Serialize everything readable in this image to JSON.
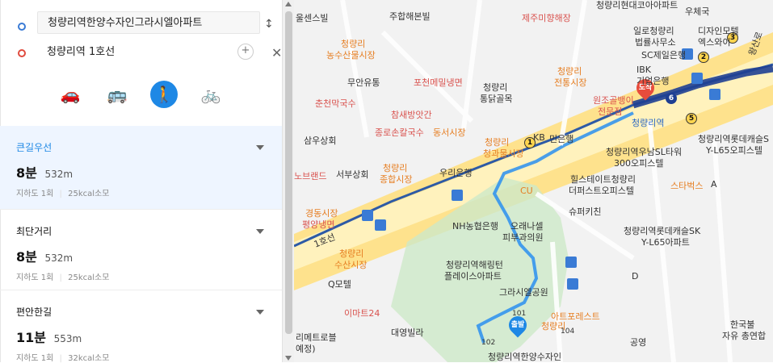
{
  "search": {
    "start_value": "청량리역한양수자인그라시엘아파트",
    "end_value": "청량리역 1호선",
    "add_label": "+",
    "swap_icon": "↕",
    "close_icon": "✕"
  },
  "modes": [
    {
      "name": "car",
      "icon": "🚗"
    },
    {
      "name": "bus",
      "icon": "🚌"
    },
    {
      "name": "walk",
      "icon": "🚶"
    },
    {
      "name": "bike",
      "icon": "🚲"
    }
  ],
  "routes": [
    {
      "title": "큰길우선",
      "time": "8분",
      "dist": "532m",
      "meta1": "지하도 1회",
      "meta2": "25kcal소모",
      "selected": true
    },
    {
      "title": "최단거리",
      "time": "8분",
      "dist": "532m",
      "meta1": "지하도 1회",
      "meta2": "25kcal소모",
      "selected": false
    },
    {
      "title": "편안한길",
      "time": "11분",
      "dist": "553m",
      "meta1": "지하도 1회",
      "meta2": "32kcal소모",
      "selected": false
    }
  ],
  "map": {
    "labels": {
      "l1": "울센스빌",
      "l2": "주합해본빌",
      "l3": "제주미향해장",
      "l4": "청량리현대코아아파트",
      "l5": "우체국",
      "l6": "일로청량리",
      "l7": "법률사무소",
      "l8": "디자인모텔",
      "l9": "엑스와이",
      "l10": "SC제일은행",
      "l11": "IBK",
      "l12": "기업은행",
      "l13": "청량리",
      "l14": "농수산물시장",
      "l15": "무안유통",
      "l16": "포천메밀냉면",
      "l17": "청량리",
      "l18": "통닭골목",
      "l19": "청량리",
      "l20": "전통시장",
      "l21": "원조골뱅이",
      "l22": "전문점",
      "l23": "춘천막국수",
      "l24": "참새방앗간",
      "l25": "종로손칼국수",
      "l26": "동서시장",
      "l27": "청량리",
      "l28": "청과물시장",
      "l29": "KB",
      "l30": "민은행",
      "l31": "청량리역우남SL타워",
      "l32": "300오피스텔",
      "l33": "청량리역롯데캐슬S",
      "l34": "Y-L65오피스텔",
      "l35": "삼우상회",
      "l36": "서부상회",
      "l37": "청량리",
      "l38": "종합시장",
      "l39": "우리은행",
      "l40": "노브랜드",
      "l41": "힐스테이트청량리",
      "l42": "더퍼스트오피스텔",
      "l43": "스타벅스",
      "l44": "경동시장",
      "l45": "평양냉면",
      "l46": "NH농협은행",
      "l47": "슈퍼키친",
      "l48": "청량리역롯데캐슬SK",
      "l49": "Y-L65아파트",
      "l50": "오래나셀",
      "l51": "피부과의원",
      "l52": "청량리",
      "l53": "수산시장",
      "l54": "청량리역해링턴",
      "l55": "플레이스아파트",
      "l56": "Q모텔",
      "l57": "그라시엘공원",
      "l58": "아트포레스트",
      "l59": "청량리",
      "l60": "이마트24",
      "l61": "대영빌라",
      "l62": "리메트로블",
      "l63": "예정)",
      "l64": "청량리역한양수자인",
      "l65": "한국불",
      "l66": "자유 총연합",
      "l67": "청량리역",
      "l68": "1호선",
      "l69": "왕산로",
      "l70": "공영",
      "l71": "CU",
      "l72": "D",
      "l73": "A",
      "l74": "101",
      "l75": "102",
      "l76": "104"
    },
    "pins": {
      "start": "출발",
      "end": "도착"
    },
    "badges": {
      "b1": "1",
      "b2": "2",
      "b3": "3",
      "b5": "5",
      "b6": "6"
    }
  }
}
